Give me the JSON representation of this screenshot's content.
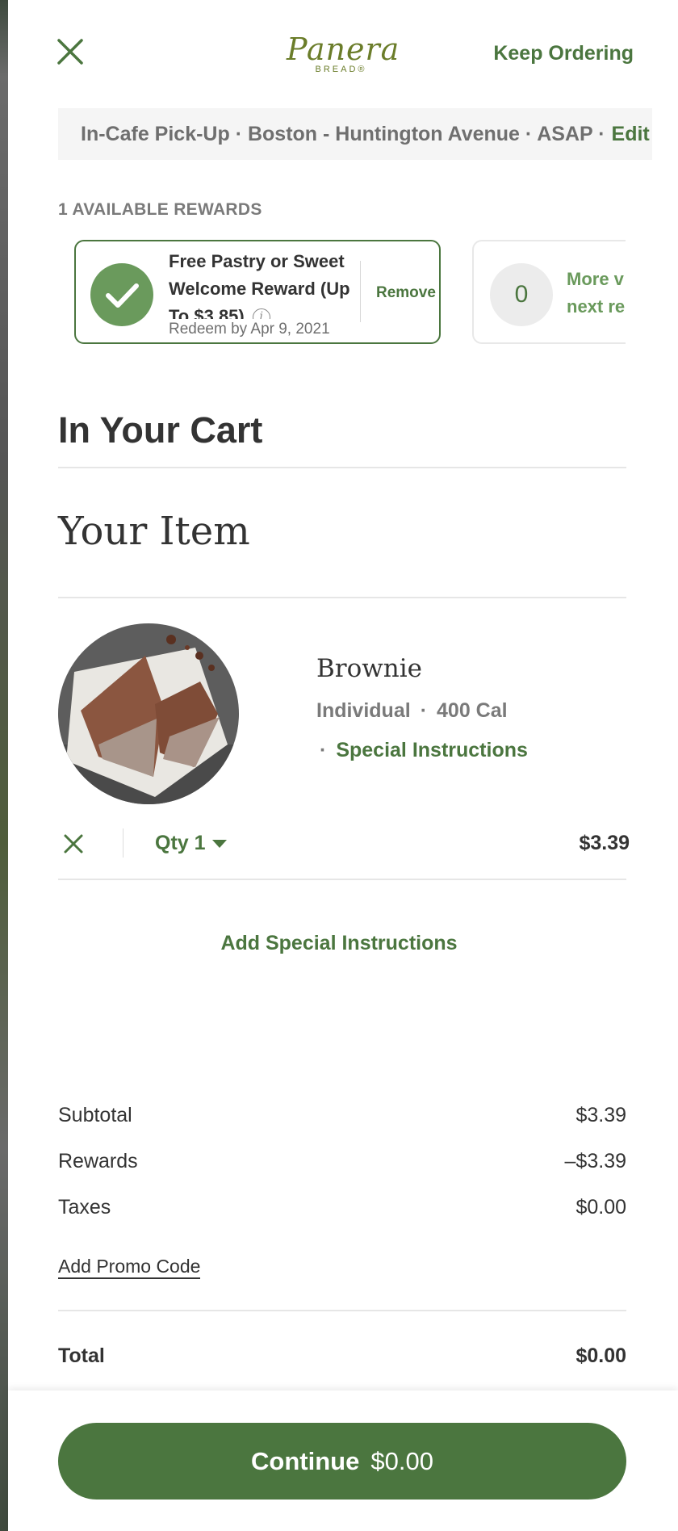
{
  "header": {
    "logo_text": "Panera",
    "logo_subtext": "BREAD®",
    "keep_ordering_label": "Keep Ordering"
  },
  "location_bar": {
    "text": "In-Cafe Pick-Up · Boston - Huntington Avenue · ASAP ·",
    "edit_label": "Edit"
  },
  "rewards": {
    "heading": "1 AVAILABLE REWARDS",
    "cards": [
      {
        "title": "Free Pastry or Sweet Welcome Reward (Up To $3.85)",
        "redeem_by": "Redeem by Apr 9, 2021",
        "remove_label": "Remove",
        "selected": true
      },
      {
        "count": "0",
        "text_line1": "More v",
        "text_line2": "next re"
      }
    ]
  },
  "cart": {
    "heading": "In Your Cart",
    "section_heading": "Your Item",
    "items": [
      {
        "name": "Brownie",
        "size": "Individual",
        "calories": "400 Cal",
        "special_instructions_label": "Special Instructions",
        "qty_label": "Qty 1",
        "price": "$3.39"
      }
    ],
    "add_special_label": "Add Special Instructions"
  },
  "summary": {
    "subtotal_label": "Subtotal",
    "subtotal_value": "$3.39",
    "rewards_label": "Rewards",
    "rewards_value": "–$3.39",
    "taxes_label": "Taxes",
    "taxes_value": "$0.00",
    "promo_label": "Add Promo Code",
    "total_label": "Total",
    "total_value": "$0.00"
  },
  "footer": {
    "continue_label": "Continue",
    "continue_amount": "$0.00"
  },
  "colors": {
    "brand_green": "#4b763f",
    "check_green": "#6a9a5c",
    "logo_olive": "#6b7d2a"
  }
}
